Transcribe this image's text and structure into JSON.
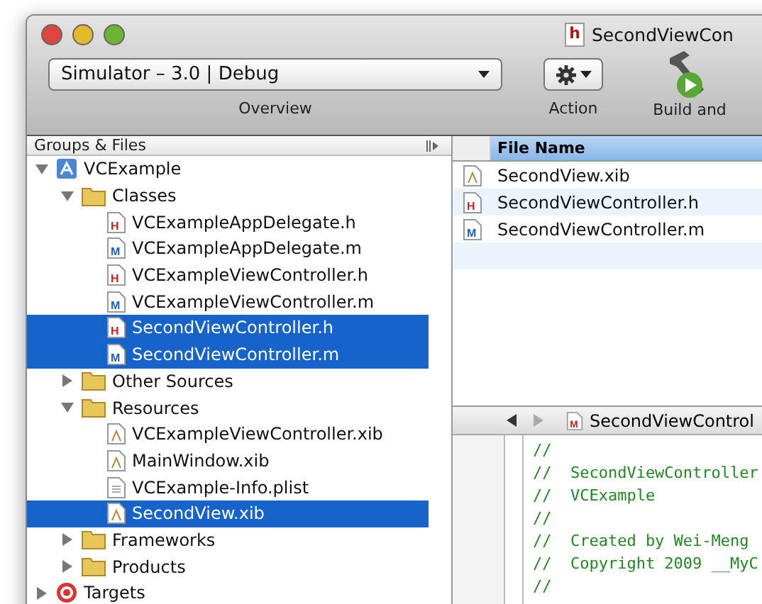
{
  "window": {
    "title": "SecondViewCon",
    "title_icon": "h"
  },
  "toolbar": {
    "scheme": "Simulator – 3.0 | Debug",
    "items": [
      {
        "label": "Overview"
      },
      {
        "label": "Action"
      },
      {
        "label": "Build and"
      }
    ]
  },
  "sidebar": {
    "header": "Groups & Files",
    "items": [
      {
        "label": "VCExample",
        "kind": "project",
        "selected": false,
        "expanded": true,
        "children": [
          {
            "label": "Classes",
            "kind": "folder",
            "selected": false,
            "expanded": true,
            "children": [
              {
                "label": "VCExampleAppDelegate.h",
                "kind": "h",
                "icon_text": "H",
                "selected": false
              },
              {
                "label": "VCExampleAppDelegate.m",
                "kind": "m",
                "icon_text": "M",
                "selected": false
              },
              {
                "label": "VCExampleViewController.h",
                "kind": "h",
                "icon_text": "H",
                "selected": false
              },
              {
                "label": "VCExampleViewController.m",
                "kind": "m",
                "icon_text": "M",
                "selected": false
              },
              {
                "label": "SecondViewController.h",
                "kind": "h",
                "icon_text": "H",
                "selected": true
              },
              {
                "label": "SecondViewController.m",
                "kind": "m",
                "icon_text": "M",
                "selected": true
              }
            ]
          },
          {
            "label": "Other Sources",
            "kind": "folder",
            "selected": false,
            "expanded": false
          },
          {
            "label": "Resources",
            "kind": "folder",
            "selected": false,
            "expanded": true,
            "children": [
              {
                "label": "VCExampleViewController.xib",
                "kind": "xib",
                "selected": false
              },
              {
                "label": "MainWindow.xib",
                "kind": "xib",
                "selected": false
              },
              {
                "label": "VCExample-Info.plist",
                "kind": "plist",
                "selected": false
              },
              {
                "label": "SecondView.xib",
                "kind": "xib",
                "selected": true
              }
            ]
          },
          {
            "label": "Frameworks",
            "kind": "folder",
            "selected": false,
            "expanded": false
          },
          {
            "label": "Products",
            "kind": "folder",
            "selected": false,
            "expanded": false
          }
        ]
      },
      {
        "label": "Targets",
        "kind": "target",
        "selected": false,
        "expanded": false
      }
    ]
  },
  "file_list": {
    "columns": [
      "File Name"
    ],
    "rows": [
      {
        "name": "SecondView.xib",
        "kind": "xib"
      },
      {
        "name": "SecondViewController.h",
        "kind": "h",
        "icon_text": "H"
      },
      {
        "name": "SecondViewController.m",
        "kind": "m",
        "icon_text": "M"
      }
    ]
  },
  "editor": {
    "file": "SecondViewControl",
    "icon_text": "M",
    "lines": [
      "//",
      "//  SecondViewController",
      "//  VCExample",
      "//",
      "//  Created by Wei-Meng",
      "//  Copyright 2009 __MyC",
      "//"
    ]
  }
}
